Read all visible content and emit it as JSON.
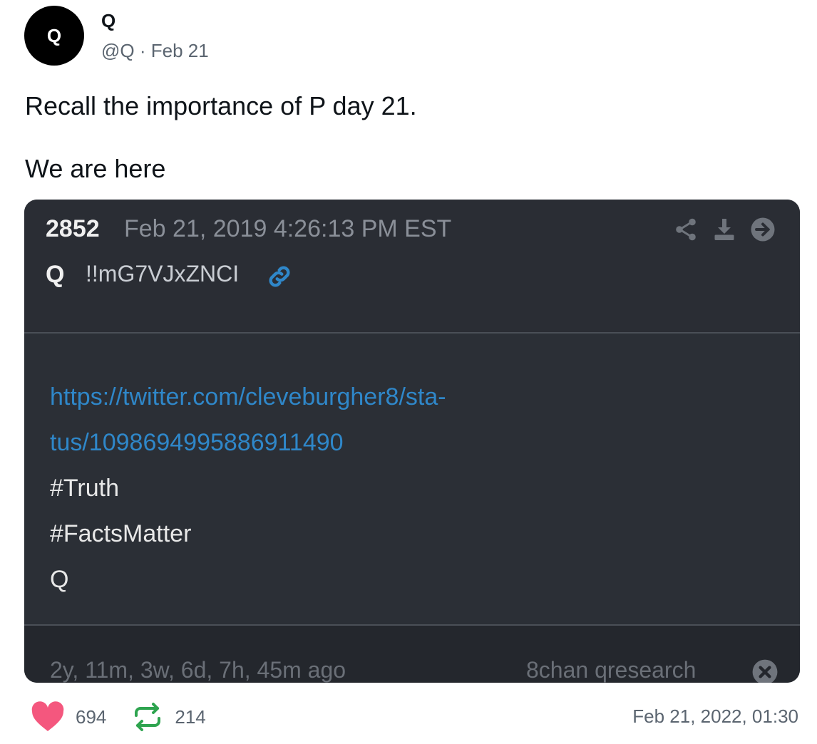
{
  "author": {
    "avatar_letter": "Q",
    "display_name": "Q",
    "handle_date": "@Q · Feb 21"
  },
  "post": {
    "line1": "Recall the importance of P day 21.",
    "line2": "We are here"
  },
  "embedded": {
    "drop_number": "2852",
    "drop_date": "Feb 21, 2019 4:26:13 PM EST",
    "author": "Q",
    "tripcode": "!!mG7VJxZNCI",
    "link_line1": "https://twitter.com/cleveburgher8/sta-",
    "link_line2": "tus/1098694995886911490",
    "body_lines": [
      "#Truth",
      "#FactsMatter",
      "Q"
    ],
    "age": "2y, 11m, 3w, 6d, 7h, 45m ago",
    "source": "8chan qresearch",
    "icons": [
      "share-icon",
      "download-icon",
      "arrow-right-icon",
      "link-icon",
      "close-icon"
    ]
  },
  "actions": {
    "likes": "694",
    "reposts": "214",
    "timestamp": "Feb 21, 2022, 01:30"
  },
  "colors": {
    "heart": "#f4577e",
    "repost": "#2ea44f",
    "link": "#2f87c9",
    "card_bg": "#2b2f36"
  }
}
